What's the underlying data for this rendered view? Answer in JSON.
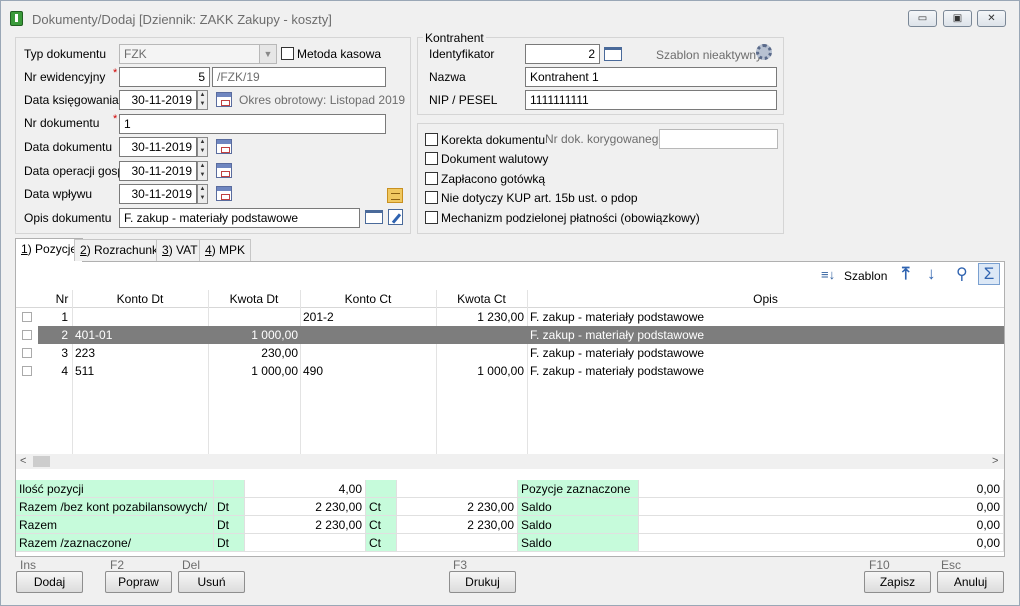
{
  "window": {
    "title": "Dokumenty/Dodaj [Dziennik: ZAKK  Zakupy - koszty]",
    "buttons": {
      "minimize": "▭",
      "restore": "▣",
      "close": "✕"
    }
  },
  "document": {
    "typ_label": "Typ dokumentu",
    "typ_value": "FZK",
    "metoda_kasowa": "Metoda kasowa",
    "nr_ewid_label": "Nr ewidencyjny",
    "nr_ewid_value": "5",
    "nr_ewid_suffix": "/FZK/19",
    "data_ksieg_label": "Data księgowania",
    "data_ksieg_value": "30-11-2019",
    "okres": "Okres obrotowy: Listopad 2019",
    "nr_dok_label": "Nr dokumentu",
    "nr_dok_value": "1",
    "data_dok_label": "Data dokumentu",
    "data_dok_value": "30-11-2019",
    "data_oper_label": "Data operacji gosp.",
    "data_oper_value": "30-11-2019",
    "data_wplywu_label": "Data wpływu",
    "data_wplywu_value": "30-11-2019",
    "opis_label": "Opis dokumentu",
    "opis_value": "F. zakup - materiały podstawowe"
  },
  "kontrahent": {
    "group_label": "Kontrahent",
    "id_label": "Identyfikator",
    "id_value": "2",
    "szablon": "Szablon nieaktywny",
    "nazwa_label": "Nazwa",
    "nazwa_value": "Kontrahent 1",
    "nip_label": "NIP / PESEL",
    "nip_value": "1111111111"
  },
  "options": {
    "korekta": "Korekta dokumentu",
    "nr_kor_label": "Nr dok. korygowanego",
    "walutowy": "Dokument walutowy",
    "gotowka": "Zapłacono gotówką",
    "kup": "Nie dotyczy KUP art. 15b ust. o pdop",
    "mpp": "Mechanizm podzielonej płatności (obowiązkowy)"
  },
  "tabs": [
    {
      "num": "1",
      "label": ") Pozycje"
    },
    {
      "num": "2",
      "label": ") Rozrachunki"
    },
    {
      "num": "3",
      "label": ") VAT"
    },
    {
      "num": "4",
      "label": ") MPK"
    }
  ],
  "toolbar": {
    "szablon": "Szablon"
  },
  "grid": {
    "headers": [
      "Nr",
      "Konto Dt",
      "Kwota Dt",
      "Konto Ct",
      "Kwota Ct",
      "Opis"
    ],
    "rows": [
      {
        "nr": "1",
        "konto_dt": "",
        "kwota_dt": "",
        "konto_ct": "201-2",
        "kwota_ct": "1 230,00",
        "opis": "F. zakup - materiały podstawowe"
      },
      {
        "nr": "2",
        "konto_dt": "401-01",
        "kwota_dt": "1 000,00",
        "konto_ct": "",
        "kwota_ct": "",
        "opis": "F. zakup - materiały podstawowe"
      },
      {
        "nr": "3",
        "konto_dt": "223",
        "kwota_dt": "230,00",
        "konto_ct": "",
        "kwota_ct": "",
        "opis": "F. zakup - materiały podstawowe"
      },
      {
        "nr": "4",
        "konto_dt": "511",
        "kwota_dt": "1 000,00",
        "konto_ct": "490",
        "kwota_ct": "1 000,00",
        "opis": "F. zakup - materiały podstawowe"
      }
    ]
  },
  "summary": {
    "rows": [
      {
        "label": "Ilość pozycji",
        "dt": "",
        "dt_val": "4,00",
        "ct": "",
        "ct_val": "",
        "label2": "Pozycje zaznaczone",
        "val2": "0,00"
      },
      {
        "label": "Razem /bez kont pozabilansowych/",
        "dt": "Dt",
        "dt_val": "2 230,00",
        "ct": "Ct",
        "ct_val": "2 230,00",
        "label2": "Saldo",
        "val2": "0,00"
      },
      {
        "label": "Razem",
        "dt": "Dt",
        "dt_val": "2 230,00",
        "ct": "Ct",
        "ct_val": "2 230,00",
        "label2": "Saldo",
        "val2": "0,00"
      },
      {
        "label": "Razem /zaznaczone/",
        "dt": "Dt",
        "dt_val": "",
        "ct": "Ct",
        "ct_val": "",
        "label2": "Saldo",
        "val2": "0,00"
      }
    ]
  },
  "footer": {
    "ins": "Ins",
    "f2": "F2",
    "del": "Del",
    "f3": "F3",
    "f10": "F10",
    "esc": "Esc",
    "dodaj": "Dodaj",
    "popraw": "Popraw",
    "usun": "Usuń",
    "drukuj": "Drukuj",
    "zapisz": "Zapisz",
    "anuluj": "Anuluj"
  }
}
